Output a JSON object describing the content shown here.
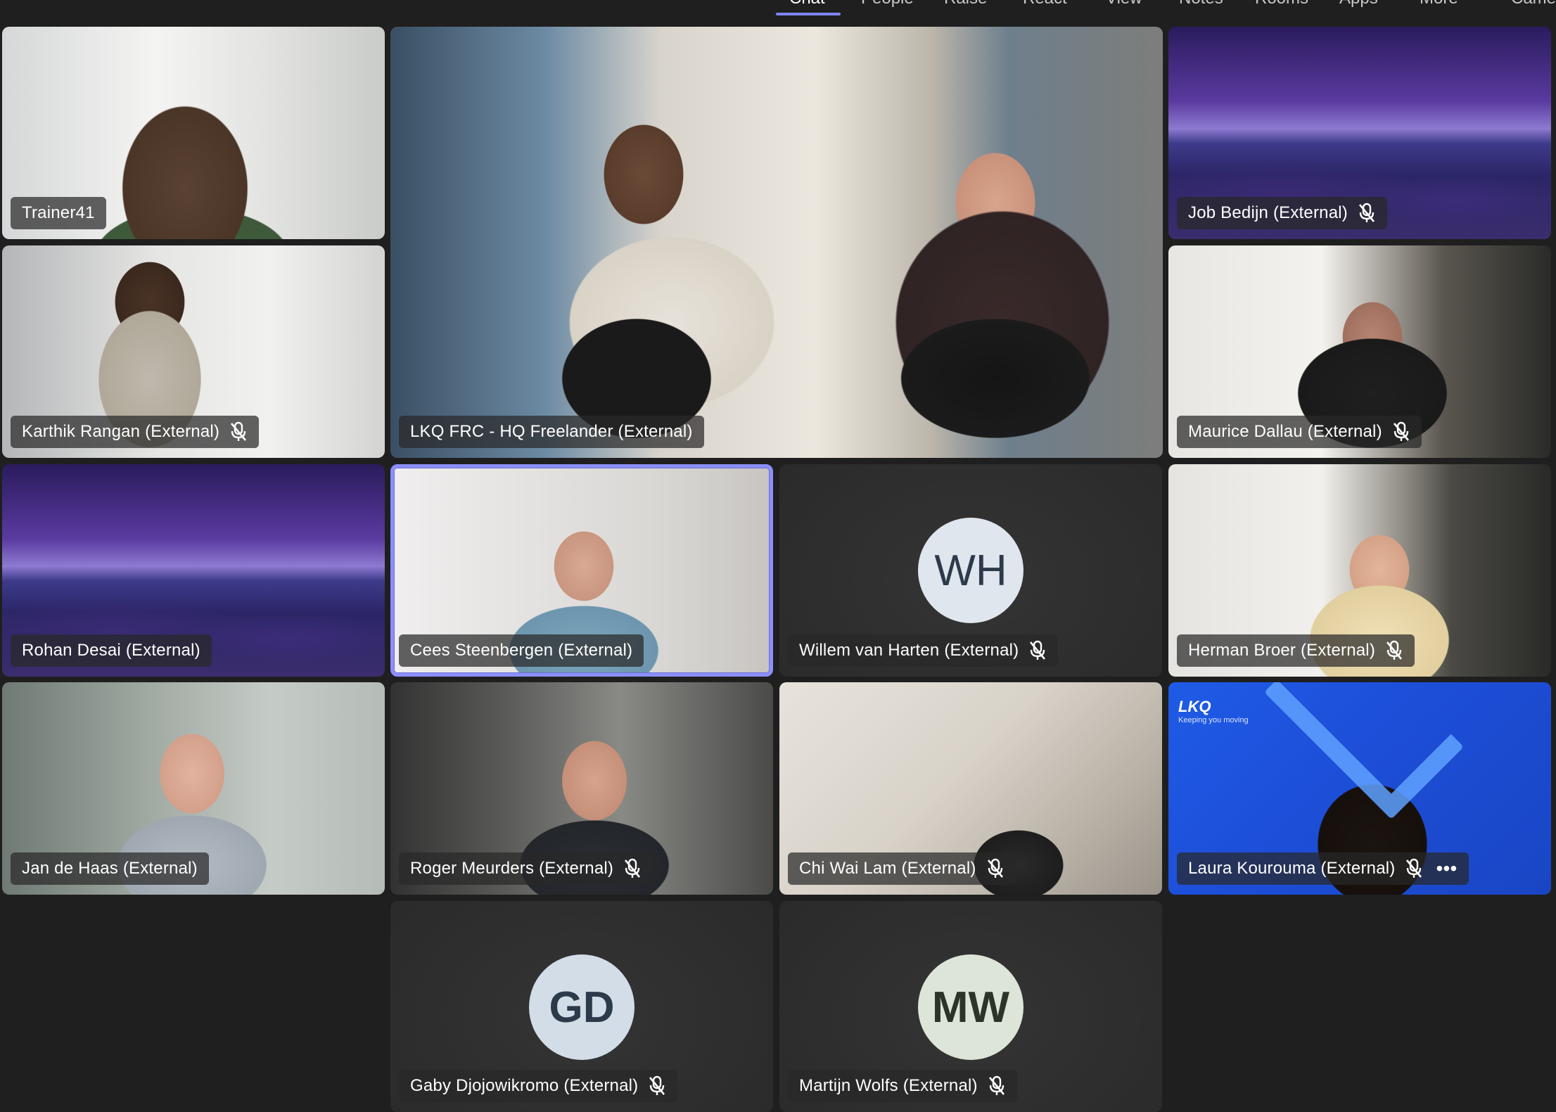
{
  "top_tabs": [
    {
      "label": "Chat",
      "active": true
    },
    {
      "label": "People",
      "active": false
    },
    {
      "label": "Raise",
      "active": false
    },
    {
      "label": "React",
      "active": false
    },
    {
      "label": "View",
      "active": false
    },
    {
      "label": "Notes",
      "active": false
    },
    {
      "label": "Rooms",
      "active": false
    },
    {
      "label": "Apps",
      "active": false
    },
    {
      "label": "More",
      "active": false
    },
    {
      "label": "Came",
      "active": false
    }
  ],
  "participants": {
    "trainer41": {
      "name": "Trainer41",
      "muted": false
    },
    "lkq_hq": {
      "name": "LKQ FRC - HQ Freelander (External)",
      "muted": false
    },
    "job": {
      "name": "Job Bedijn (External)",
      "muted": true
    },
    "karthik": {
      "name": "Karthik Rangan (External)",
      "muted": true
    },
    "maurice": {
      "name": "Maurice Dallau (External)",
      "muted": true
    },
    "rohan": {
      "name": "Rohan Desai (External)",
      "muted": false
    },
    "cees": {
      "name": "Cees Steenbergen (External)",
      "muted": false,
      "selected": true
    },
    "willem": {
      "name": "Willem van Harten (External)",
      "muted": true,
      "initials": "WH"
    },
    "herman": {
      "name": "Herman Broer (External)",
      "muted": true
    },
    "jan": {
      "name": "Jan de Haas (External)",
      "muted": false
    },
    "roger": {
      "name": "Roger Meurders (External)",
      "muted": true
    },
    "chi": {
      "name": "Chi Wai Lam (External)",
      "muted": true
    },
    "laura": {
      "name": "Laura Kourouma (External)",
      "muted": true,
      "more": "•••",
      "background_logo": "LKQ",
      "background_tagline": "Keeping you moving"
    },
    "gaby": {
      "name": "Gaby Djojowikromo (External)",
      "muted": true,
      "initials": "GD"
    },
    "martijn": {
      "name": "Martijn Wolfs (External)",
      "muted": true,
      "initials": "MW"
    }
  },
  "colors": {
    "stage_bg": "#1f1f1f",
    "active_tab": "#7f85f5",
    "selected_border": "#8b8fff",
    "avatar_wh": "#dfe6ed",
    "avatar_gd": "#d3dde8",
    "avatar_mw": "#dde5d8"
  }
}
